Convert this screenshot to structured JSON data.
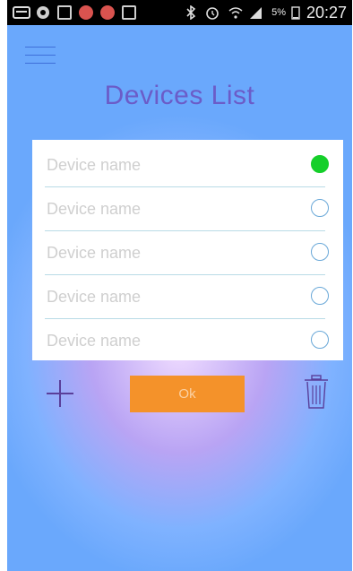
{
  "status_bar": {
    "battery_percent": "5%",
    "time": "20:27",
    "icons": [
      "keyboard-icon",
      "shield-icon",
      "image-icon",
      "notification-icon",
      "notification-icon",
      "usb-icon",
      "bluetooth-icon",
      "alarm-icon",
      "wifi-icon",
      "signal-icon",
      "battery-icon"
    ]
  },
  "header": {
    "menu_icon": "hamburger-menu-icon",
    "title": "Devices List"
  },
  "devices": [
    {
      "name": "Device name",
      "selected": true
    },
    {
      "name": "Device name",
      "selected": false
    },
    {
      "name": "Device name",
      "selected": false
    },
    {
      "name": "Device name",
      "selected": false
    },
    {
      "name": "Device name",
      "selected": false
    }
  ],
  "actions": {
    "add_icon": "plus-icon",
    "ok_label": "Ok",
    "delete_icon": "trash-icon"
  },
  "colors": {
    "accent": "#f4922a",
    "selected": "#15cf2a",
    "title": "#6b5cc8"
  }
}
